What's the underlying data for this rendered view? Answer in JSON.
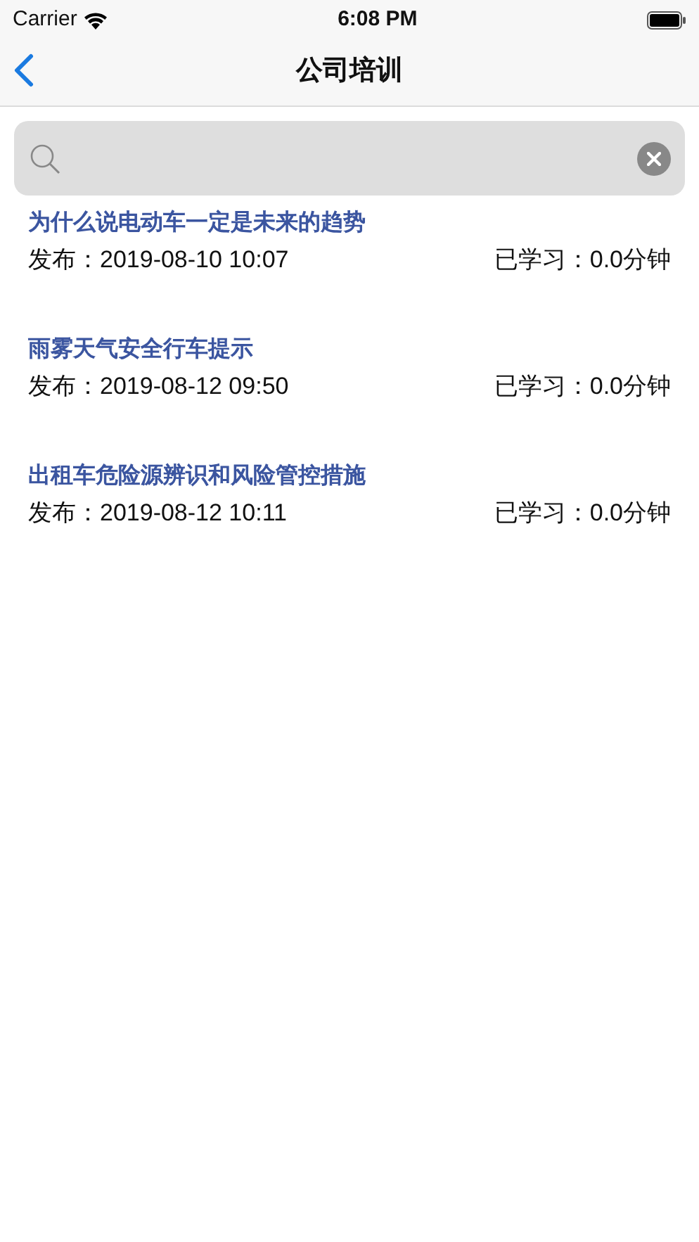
{
  "status_bar": {
    "carrier": "Carrier",
    "time": "6:08 PM"
  },
  "nav_bar": {
    "title": "公司培训"
  },
  "articles": [
    {
      "title": "为什么说电动车一定是未来的趋势",
      "published": "发布：2019-08-10 10:07",
      "studied": "已学习：0.0分钟"
    },
    {
      "title": "雨雾天气安全行车提示",
      "published": "发布：2019-08-12 09:50",
      "studied": "已学习：0.0分钟"
    },
    {
      "title": "出租车危险源辨识和风险管控措施",
      "published": "发布：2019-08-12 10:11",
      "studied": "已学习：0.0分钟"
    }
  ]
}
